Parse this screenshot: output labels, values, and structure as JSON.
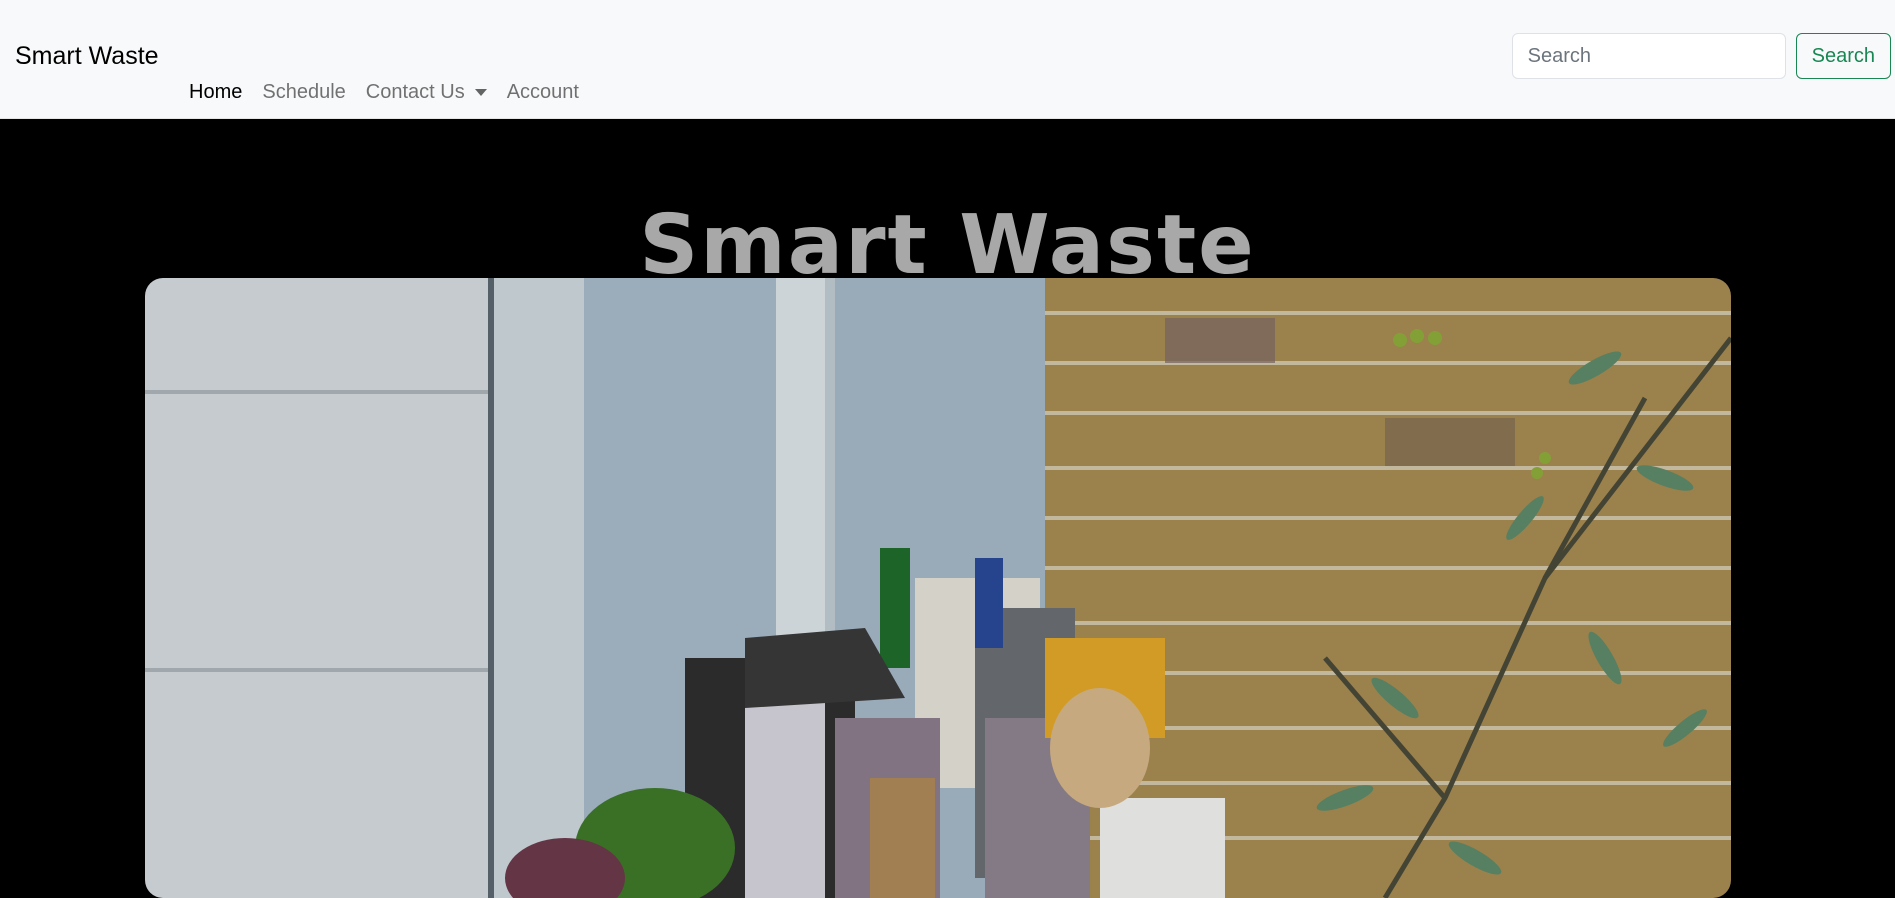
{
  "navbar": {
    "brand": "Smart Waste",
    "links": [
      {
        "label": "Home"
      },
      {
        "label": "Schedule"
      },
      {
        "label": "Contact Us"
      },
      {
        "label": "Account"
      }
    ],
    "search": {
      "placeholder": "Search",
      "button_label": "Search"
    }
  },
  "hero": {
    "title": "Smart Waste",
    "image_icon": "trash-pile-photo"
  },
  "colors": {
    "navbar_bg": "#f8f9fa",
    "page_bg": "#000000",
    "accent": "#198754",
    "title": "#a8a8a8"
  }
}
